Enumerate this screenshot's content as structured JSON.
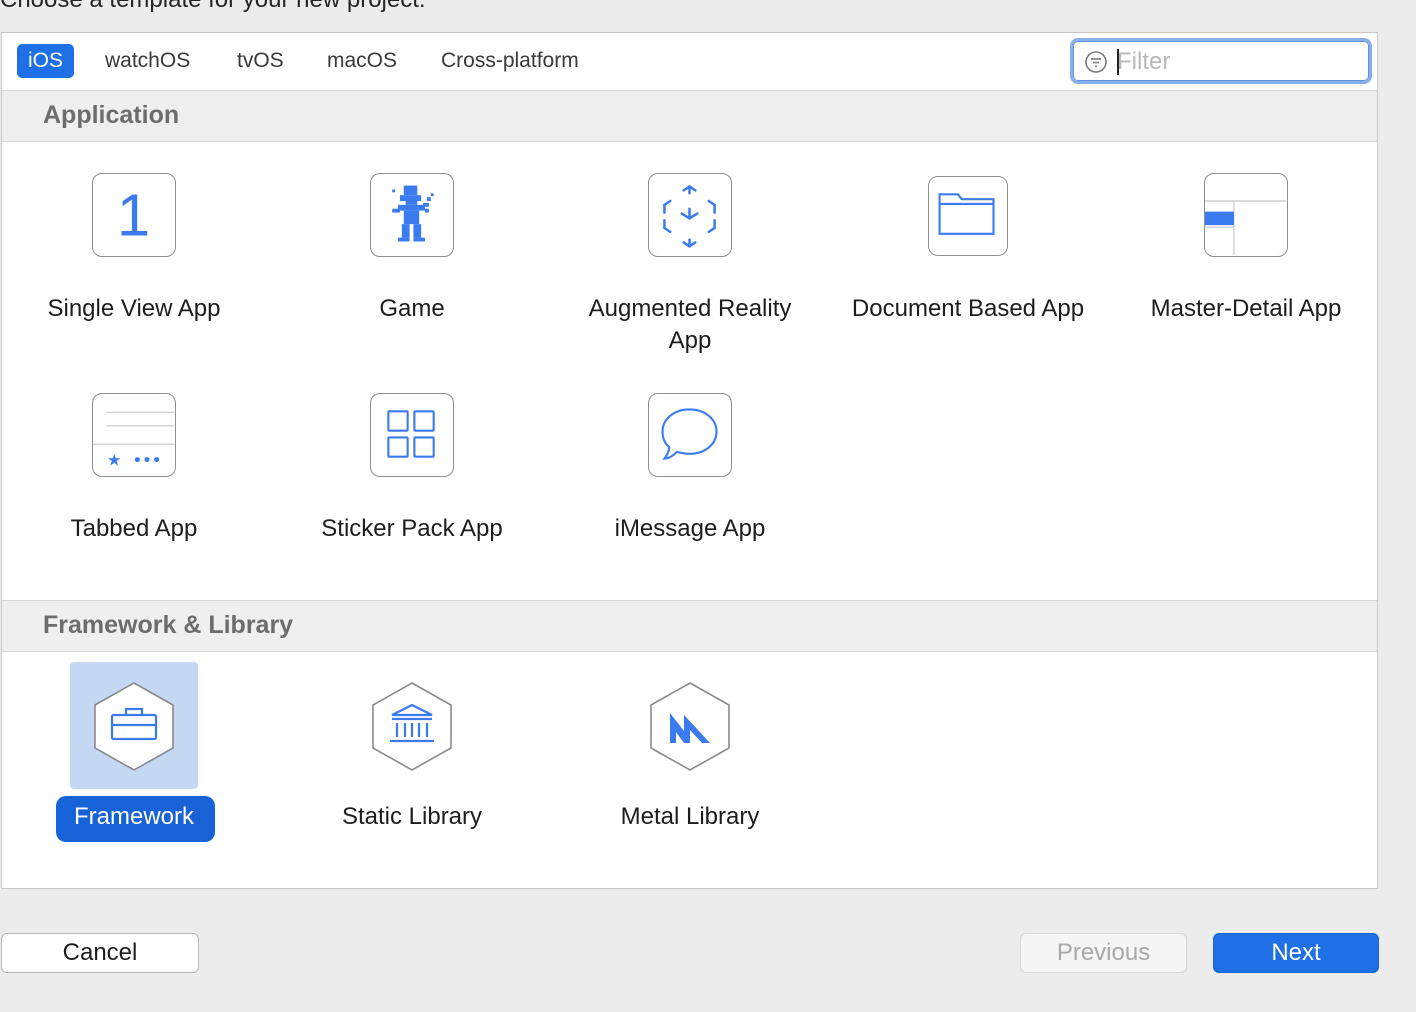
{
  "heading": "Choose a template for your new project:",
  "tabs": [
    {
      "label": "iOS",
      "active": true
    },
    {
      "label": "watchOS"
    },
    {
      "label": "tvOS"
    },
    {
      "label": "macOS"
    },
    {
      "label": "Cross-platform"
    }
  ],
  "filter": {
    "placeholder": "Filter",
    "value": ""
  },
  "sections": [
    {
      "title": "Application",
      "items": [
        {
          "label": "Single View App",
          "icon": "single-view-icon"
        },
        {
          "label": "Game",
          "icon": "game-robot-icon"
        },
        {
          "label": "Augmented Reality App",
          "icon": "ar-cube-icon"
        },
        {
          "label": "Document Based App",
          "icon": "folder-icon"
        },
        {
          "label": "Master-Detail App",
          "icon": "master-detail-icon"
        },
        {
          "label": "Tabbed App",
          "icon": "tab-bar-icon"
        },
        {
          "label": "Sticker Pack App",
          "icon": "sticker-grid-icon"
        },
        {
          "label": "iMessage App",
          "icon": "speech-bubble-icon"
        }
      ]
    },
    {
      "title": "Framework & Library",
      "items": [
        {
          "label": "Framework",
          "icon": "toolbox-icon",
          "selected": true
        },
        {
          "label": "Static Library",
          "icon": "library-building-icon"
        },
        {
          "label": "Metal Library",
          "icon": "metal-icon"
        }
      ]
    }
  ],
  "buttons": {
    "cancel": "Cancel",
    "previous": "Previous",
    "next": "Next"
  },
  "colors": {
    "accent": "#1f6fe6",
    "icon_blue": "#3b7bf0",
    "selection_bg": "#c4d8f4"
  }
}
